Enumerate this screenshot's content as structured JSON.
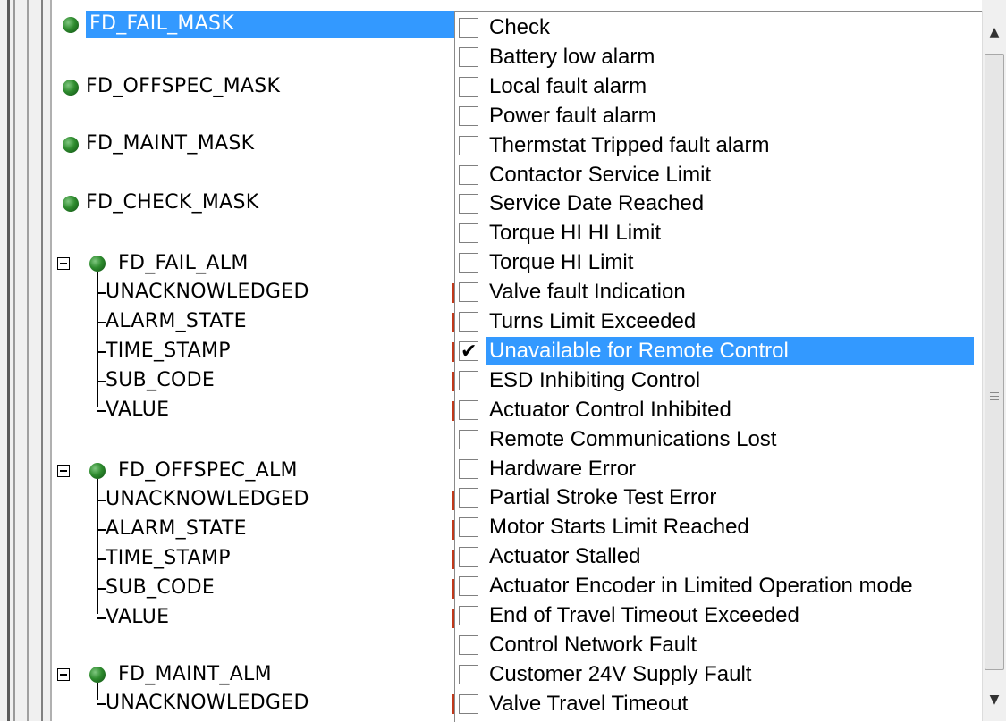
{
  "tree": {
    "top_items": [
      {
        "label": "FD_FAIL_MASK",
        "selected": true
      },
      {
        "label": "FD_OFFSPEC_MASK"
      },
      {
        "label": "FD_MAINT_MASK"
      },
      {
        "label": "FD_CHECK_MASK"
      }
    ],
    "groups": [
      {
        "label": "FD_FAIL_ALM",
        "children": [
          "UNACKNOWLEDGED",
          "ALARM_STATE",
          "TIME_STAMP",
          "SUB_CODE",
          "VALUE"
        ]
      },
      {
        "label": "FD_OFFSPEC_ALM",
        "children": [
          "UNACKNOWLEDGED",
          "ALARM_STATE",
          "TIME_STAMP",
          "SUB_CODE",
          "VALUE"
        ]
      },
      {
        "label": "FD_MAINT_ALM",
        "children": [
          "UNACKNOWLEDGED"
        ]
      }
    ]
  },
  "checklist": {
    "items": [
      {
        "label": "Check",
        "checked": false
      },
      {
        "label": "Battery low alarm",
        "checked": false
      },
      {
        "label": "Local fault alarm",
        "checked": false
      },
      {
        "label": "Power fault alarm",
        "checked": false
      },
      {
        "label": "Thermstat Tripped fault alarm",
        "checked": false
      },
      {
        "label": "Contactor Service Limit",
        "checked": false
      },
      {
        "label": "Service Date Reached",
        "checked": false
      },
      {
        "label": "Torque HI HI Limit",
        "checked": false
      },
      {
        "label": "Torque HI Limit",
        "checked": false
      },
      {
        "label": "Valve fault Indication",
        "checked": false
      },
      {
        "label": "Turns Limit Exceeded",
        "checked": false
      },
      {
        "label": "Unavailable for Remote Control",
        "checked": true,
        "selected": true
      },
      {
        "label": "ESD Inhibiting Control",
        "checked": false
      },
      {
        "label": "Actuator Control Inhibited",
        "checked": false
      },
      {
        "label": "Remote Communications Lost",
        "checked": false
      },
      {
        "label": "Hardware Error",
        "checked": false
      },
      {
        "label": "Partial Stroke Test Error",
        "checked": false
      },
      {
        "label": "Motor Starts Limit Reached",
        "checked": false
      },
      {
        "label": "Actuator Stalled",
        "checked": false
      },
      {
        "label": "Actuator Encoder in Limited Operation mode",
        "checked": false
      },
      {
        "label": "End of Travel Timeout Exceeded",
        "checked": false
      },
      {
        "label": "Control Network Fault",
        "checked": false
      },
      {
        "label": "Customer 24V Supply Fault",
        "checked": false
      },
      {
        "label": "Valve Travel Timeout",
        "checked": false
      }
    ]
  },
  "colors": {
    "selection": "#3399ff",
    "status_dot": "#2e8b2e",
    "tick": "#c0381a"
  },
  "icons": {
    "scroll_up": "▲",
    "scroll_down": "▼",
    "collapse": "minus-box-icon",
    "status": "green-dot-icon"
  }
}
